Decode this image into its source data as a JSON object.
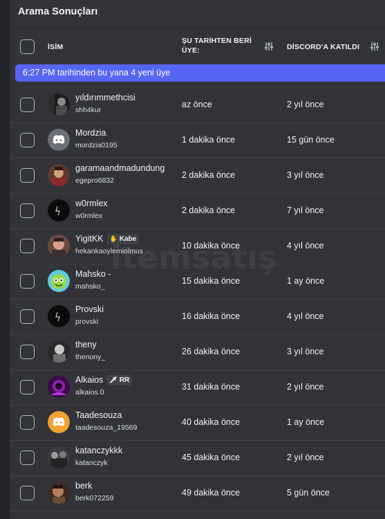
{
  "header": {
    "title": "Arama Sonuçları"
  },
  "columns": {
    "name": "İSİM",
    "since_line1": "ŞU TARİHTEN BERİ",
    "since_line2": "ÜYE:",
    "joined": "DİSCORD'A KATILDI"
  },
  "banner": {
    "text": "6:27 PM tarihinden bu yana 4 yeni üye"
  },
  "watermark": "itemsatış",
  "members": [
    {
      "name": "yıldırımmethcisi",
      "handle": "shh4kur",
      "since": "az önce",
      "joined": "2 yıl önce",
      "avatar": "photo-dark",
      "tag": ""
    },
    {
      "name": "Mordzia",
      "handle": "mordzia0195",
      "since": "1 dakika önce",
      "joined": "15 gün önce",
      "avatar": "discord-grey",
      "tag": ""
    },
    {
      "name": "garamaandmadundung",
      "handle": "egepro6832",
      "since": "2 dakika önce",
      "joined": "3 yıl önce",
      "avatar": "photo-warm",
      "tag": ""
    },
    {
      "name": "w0rmlex",
      "handle": "w0rmlex",
      "since": "2 dakika önce",
      "joined": "7 yıl önce",
      "avatar": "photo-black",
      "tag": ""
    },
    {
      "name": "YigitKK",
      "handle": "hekankaoylemiolmus",
      "since": "10 dakika önce",
      "joined": "4 yıl önce",
      "avatar": "photo-face",
      "tag": "Kabe"
    },
    {
      "name": "Mahsko -",
      "handle": "mahsko_",
      "since": "15 dakika önce",
      "joined": "1 ay önce",
      "avatar": "photo-green",
      "tag": ""
    },
    {
      "name": "Provski",
      "handle": "provski",
      "since": "16 dakika önce",
      "joined": "4 yıl önce",
      "avatar": "photo-black",
      "tag": ""
    },
    {
      "name": "theny",
      "handle": "thenony_",
      "since": "26 dakika önce",
      "joined": "3 yıl önce",
      "avatar": "photo-grey",
      "tag": ""
    },
    {
      "name": "Alkaios",
      "handle": "alkaios.0",
      "since": "31 dakika önce",
      "joined": "2 yıl önce",
      "avatar": "photo-purple",
      "tag": "RR"
    },
    {
      "name": "Taadesouza",
      "handle": "taadesouza_19569",
      "since": "40 dakika önce",
      "joined": "1 ay önce",
      "avatar": "discord-orange",
      "tag": ""
    },
    {
      "name": "katanczykkk",
      "handle": "katanczyk",
      "since": "45 dakika önce",
      "joined": "2 yıl önce",
      "avatar": "photo-group",
      "tag": ""
    },
    {
      "name": "berk",
      "handle": "berk072259",
      "since": "49 dakika önce",
      "joined": "5 gün önce",
      "avatar": "photo-warm2",
      "tag": ""
    }
  ]
}
